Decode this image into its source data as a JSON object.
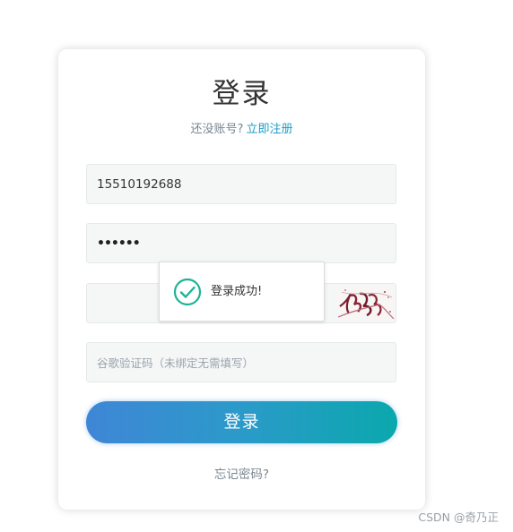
{
  "login": {
    "title": "登录",
    "no_account_text": "还没账号?",
    "register_link": "立即注册",
    "phone_value": "15510192688",
    "password_dots": "••••••",
    "google_code_placeholder": "谷歌验证码（未绑定无需填写）",
    "submit_label": "登录",
    "forgot_password": "忘记密码?"
  },
  "toast": {
    "message": "登录成功!",
    "icon": "check-circle-icon",
    "color": "#1fb39a"
  },
  "colors": {
    "link": "#1a9cc8",
    "button_gradient_start": "#3f86d6",
    "button_gradient_end": "#0aa8ad"
  },
  "watermark": "CSDN @奇乃正"
}
